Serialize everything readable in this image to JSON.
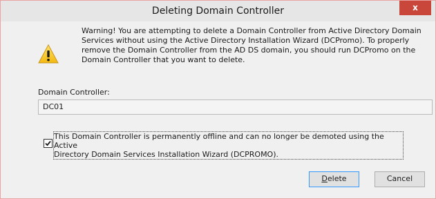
{
  "window": {
    "title": "Deleting Domain Controller",
    "close_label": "x"
  },
  "icons": {
    "warning": "warning-icon",
    "close": "close-icon",
    "check": "checkmark-icon"
  },
  "message": {
    "lines": [
      "Warning! You are attempting to delete a Domain Controller from Active Directory Domain",
      "Services without using the Active Directory Installation Wizard (DCPromo). To properly",
      "remove the Domain Controller from the AD DS domain, you should run DCPromo on the",
      "Domain Controller that you want to delete."
    ]
  },
  "domain_controller": {
    "label": "Domain Controller:",
    "value": "DC01"
  },
  "offline_checkbox": {
    "checked": true,
    "lines": [
      "This Domain Controller is permanently offline and can no longer be demoted using the Active",
      "Directory Domain Services Installation Wizard (DCPROMO)."
    ]
  },
  "buttons": {
    "delete_mnemonic": "D",
    "delete_rest": "elete",
    "cancel_label": "Cancel"
  },
  "colors": {
    "close_button": "#c8463a",
    "focus_border": "#3399ff"
  }
}
